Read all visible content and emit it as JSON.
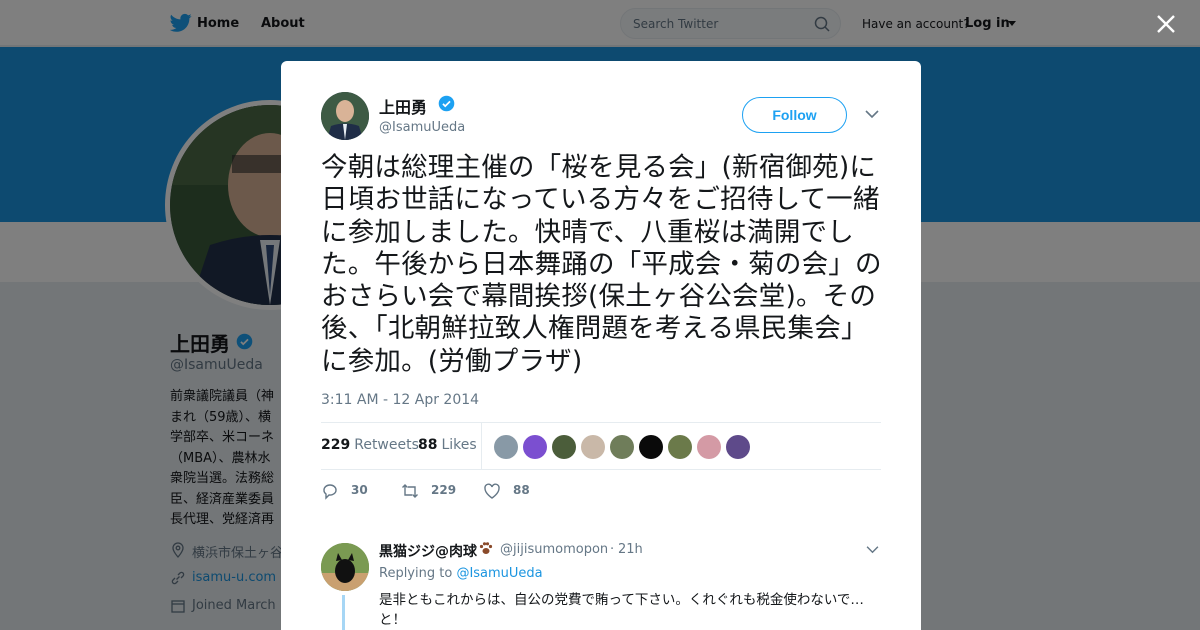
{
  "nav": {
    "home_label": "Home",
    "about_label": "About",
    "search_placeholder": "Search Twitter",
    "have_account": "Have an account?",
    "login_label": "Log in"
  },
  "profile": {
    "name": "上田勇",
    "handle": "@IsamuUeda",
    "bio": "前衆議院議員（神\nまれ（59歳）、横\n学部卒、米コーネ\n（MBA）、農林水\n衆院当選。法務総\n臣、経済産業委員\n長代理、党経済再",
    "location": "横浜市保土ヶ谷",
    "url": "isamu-u.com",
    "joined": "Joined March"
  },
  "tweet": {
    "name": "上田勇",
    "handle": "@IsamuUeda",
    "follow_label": "Follow",
    "text": "今朝は総理主催の「桜を見る会」(新宿御苑)に日頃お世話になっている方々をご招待して一緒に参加しました。快晴で、八重桜は満開でした。午後から日本舞踊の「平成会・菊の会」のおさらい会で幕間挨拶(保土ヶ谷公会堂)。その後、「北朝鮮拉致人権問題を考える県民集会」に参加。(労働プラザ)",
    "timestamp": "3:11 AM - 12 Apr 2014",
    "retweets_count": "229",
    "retweets_label": "Retweets",
    "likes_count": "88",
    "likes_label": "Likes",
    "actions": {
      "reply_count": "30",
      "retweet_count": "229",
      "like_count": "88"
    },
    "likers": [
      {
        "icon": "default-avatar",
        "color": "#8899a6"
      },
      {
        "icon": "purple-swirl-avatar",
        "color": "#7b4fd0"
      },
      {
        "icon": "tree-avatar",
        "color": "#4b5d3a"
      },
      {
        "icon": "person-avatar",
        "color": "#c9b8a8"
      },
      {
        "icon": "logo-avatar",
        "color": "#6f7d5a"
      },
      {
        "icon": "green-circle-avatar",
        "color": "#0a0a0a"
      },
      {
        "icon": "field-avatar",
        "color": "#6b7a4a"
      },
      {
        "icon": "flower-avatar",
        "color": "#d49aa5"
      },
      {
        "icon": "purple-avatar",
        "color": "#5e4a8a"
      }
    ]
  },
  "reply": {
    "name": "黒猫ジジ@肉球",
    "handle": "@jijisumomopon",
    "separator": "·",
    "time": "21h",
    "replying_prefix": "Replying to",
    "replying_to": "@IsamuUeda",
    "text": "是非ともこれからは、自公の党費で賄って下さい。くれぐれも税金使わないで…と！"
  },
  "colors": {
    "accent": "#1da1f2",
    "banner": "#1b95e0",
    "verified": "#1da1f2"
  }
}
